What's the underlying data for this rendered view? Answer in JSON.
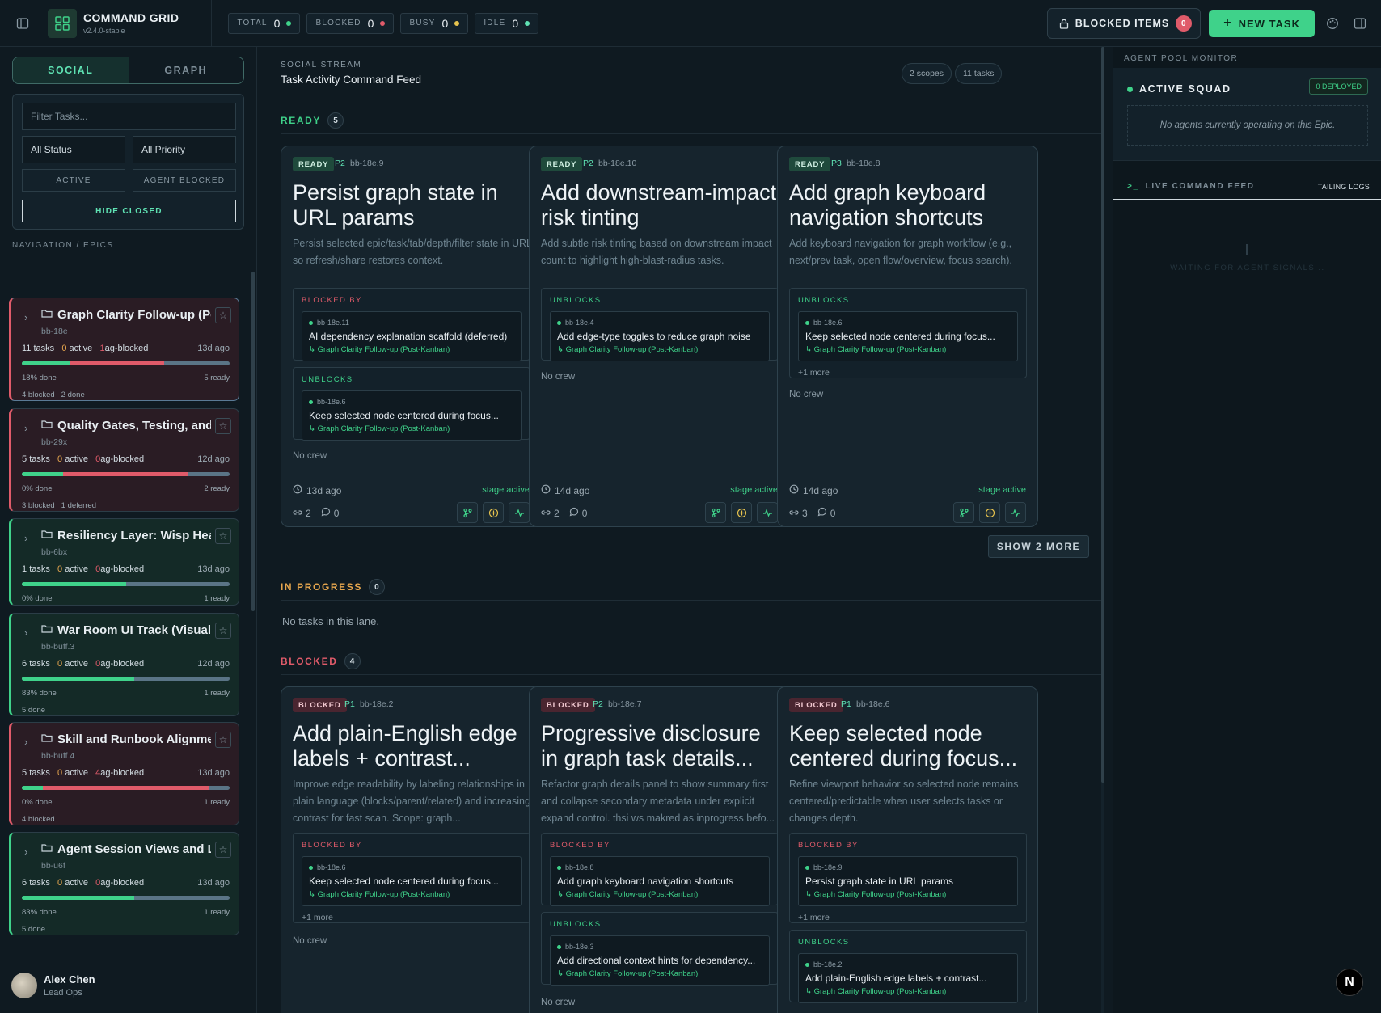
{
  "app": {
    "title": "COMMAND GRID",
    "version": "v2.4.0-stable"
  },
  "counters": [
    {
      "label": "TOTAL",
      "value": "0",
      "color": "#3fd28a"
    },
    {
      "label": "BLOCKED",
      "value": "0",
      "color": "#e05b6a"
    },
    {
      "label": "BUSY",
      "value": "0",
      "color": "#e6c34e"
    },
    {
      "label": "IDLE",
      "value": "0",
      "color": "#5fe2b3"
    }
  ],
  "toolbar": {
    "blocked_label": "BLOCKED ITEMS",
    "blocked_count": "0",
    "new_task_label": "NEW TASK"
  },
  "sidebar": {
    "tabs": {
      "social": "SOCIAL",
      "graph": "GRAPH"
    },
    "filter": {
      "placeholder": "Filter Tasks...",
      "status": "All Status",
      "priority": "All Priority",
      "active": "ACTIVE",
      "agent_blocked": "AGENT BLOCKED",
      "hide_closed": "HIDE CLOSED"
    },
    "nav_label": "NAVIGATION / EPICS",
    "epics": [
      {
        "title": "Graph Clarity Follow-up (Post-Kanban)",
        "id": "bb-18e",
        "tasks": "11",
        "active": "0",
        "blocked": "1",
        "ago": "13d ago",
        "pct": "18% done",
        "ready": "5 ready",
        "foot": [
          "4 blocked",
          "2 done"
        ],
        "done_frac": 0.18,
        "ready_frac": 0.27,
        "blocked_frac": 0.45
      },
      {
        "title": "Quality Gates, Testing, and Release",
        "id": "bb-29x",
        "tasks": "5",
        "active": "0",
        "blocked": "0",
        "ago": "12d ago",
        "pct": "0% done",
        "ready": "2 ready",
        "foot": [
          "3 blocked",
          "1 deferred"
        ],
        "done_frac": 0.0,
        "ready_frac": 0.4,
        "blocked_frac": 0.6
      },
      {
        "title": "Resiliency Layer: Wisp Heartbeats",
        "id": "bb-6bx",
        "tasks": "1",
        "active": "0",
        "blocked": "0",
        "ago": "13d ago",
        "pct": "0% done",
        "ready": "1 ready",
        "foot": [],
        "done_frac": 0.0,
        "ready_frac": 1.0,
        "blocked_frac": 0.0
      },
      {
        "title": "War Room UI Track (Visual Polish)",
        "id": "bb-buff.3",
        "tasks": "6",
        "active": "0",
        "blocked": "0",
        "ago": "12d ago",
        "pct": "83% done",
        "ready": "1 ready",
        "foot": [
          "5 done"
        ],
        "done_frac": 0.83,
        "ready_frac": 0.17,
        "blocked_frac": 0.0
      },
      {
        "title": "Skill and Runbook Alignment",
        "id": "bb-buff.4",
        "tasks": "5",
        "active": "0",
        "blocked": "4",
        "ago": "13d ago",
        "pct": "0% done",
        "ready": "1 ready",
        "foot": [
          "4 blocked"
        ],
        "done_frac": 0.0,
        "ready_frac": 0.2,
        "blocked_frac": 0.8
      },
      {
        "title": "Agent Session Views and Logs",
        "id": "bb-u6f",
        "tasks": "6",
        "active": "0",
        "blocked": "0",
        "ago": "13d ago",
        "pct": "83% done",
        "ready": "1 ready",
        "foot": [
          "5 done"
        ],
        "done_frac": 0.83,
        "ready_frac": 0.17,
        "blocked_frac": 0.0
      }
    ],
    "epic_labels": {
      "tasks": "tasks",
      "active": "active",
      "blocked": "ag-blocked"
    },
    "user": {
      "name": "Alex Chen",
      "role": "Lead Ops"
    }
  },
  "main": {
    "stream_label": "SOCIAL STREAM",
    "stream_title": "Task Activity Command Feed",
    "scopes": "2 scopes",
    "tasks": "11 tasks",
    "lanes": {
      "ready": {
        "label": "READY",
        "count": "5"
      },
      "progress": {
        "label": "IN PROGRESS",
        "count": "0",
        "empty": "No tasks in this lane."
      },
      "blocked": {
        "label": "BLOCKED",
        "count": "4"
      }
    },
    "show_more": "SHOW 2 MORE",
    "labels": {
      "blocked_by": "BLOCKED BY",
      "unblocks": "UNBLOCKS",
      "no_crew": "No crew",
      "stage": "stage active"
    },
    "ready_cards": [
      {
        "status": "READY",
        "prio": "P2",
        "id": "bb-18e.9",
        "title": "Persist graph state in URL params",
        "desc": "Persist selected epic/task/tab/depth/filter state in URL so refresh/share restores context.",
        "blocked_by": {
          "id": "bb-18e.11",
          "title": "AI dependency explanation scaffold (deferred)",
          "epic": "↳ Graph Clarity Follow-up (Post-Kanban)"
        },
        "unblocks": {
          "id": "bb-18e.6",
          "title": "Keep selected node centered during focus...",
          "epic": "↳ Graph Clarity Follow-up (Post-Kanban)"
        },
        "ago": "13d ago",
        "links": "2",
        "comments": "0"
      },
      {
        "status": "READY",
        "prio": "P2",
        "id": "bb-18e.10",
        "title": "Add downstream-impact risk tinting",
        "desc": "Add subtle risk tinting based on downstream impact count to highlight high-blast-radius tasks.",
        "unblocks": {
          "id": "bb-18e.4",
          "title": "Add edge-type toggles to reduce graph noise",
          "epic": "↳ Graph Clarity Follow-up (Post-Kanban)"
        },
        "ago": "14d ago",
        "links": "2",
        "comments": "0"
      },
      {
        "status": "READY",
        "prio": "P3",
        "id": "bb-18e.8",
        "title": "Add graph keyboard navigation shortcuts",
        "desc": "Add keyboard navigation for graph workflow (e.g., next/prev task, open flow/overview, focus search).",
        "unblocks": {
          "id": "bb-18e.6",
          "title": "Keep selected node centered during focus...",
          "epic": "↳ Graph Clarity Follow-up (Post-Kanban)",
          "more": "+1 more"
        },
        "ago": "14d ago",
        "links": "3",
        "comments": "0"
      }
    ],
    "blocked_cards": [
      {
        "status": "BLOCKED",
        "prio": "P1",
        "id": "bb-18e.2",
        "title": "Add plain-English edge labels + contrast...",
        "desc": "Improve edge readability by labeling relationships in plain language (blocks/parent/related) and increasing contrast for fast scan. Scope: graph...",
        "blocked_by": {
          "id": "bb-18e.6",
          "title": "Keep selected node centered during focus...",
          "epic": "↳ Graph Clarity Follow-up (Post-Kanban)",
          "more": "+1 more"
        }
      },
      {
        "status": "BLOCKED",
        "prio": "P2",
        "id": "bb-18e.7",
        "title": "Progressive disclosure in graph task details...",
        "desc": "Refactor graph details panel to show summary first and collapse secondary metadata under explicit expand control. thsi ws makred as inprogress befo...",
        "blocked_by": {
          "id": "bb-18e.8",
          "title": "Add graph keyboard navigation shortcuts",
          "epic": "↳ Graph Clarity Follow-up (Post-Kanban)"
        },
        "unblocks": {
          "id": "bb-18e.3",
          "title": "Add directional context hints for dependency...",
          "epic": "↳ Graph Clarity Follow-up (Post-Kanban)"
        }
      },
      {
        "status": "BLOCKED",
        "prio": "P1",
        "id": "bb-18e.6",
        "title": "Keep selected node centered during focus...",
        "desc": "Refine viewport behavior so selected node remains centered/predictable when user selects tasks or changes depth.",
        "blocked_by": {
          "id": "bb-18e.9",
          "title": "Persist graph state in URL params",
          "epic": "↳ Graph Clarity Follow-up (Post-Kanban)",
          "more": "+1 more"
        },
        "unblocks": {
          "id": "bb-18e.2",
          "title": "Add plain-English edge labels + contrast...",
          "epic": "↳ Graph Clarity Follow-up (Post-Kanban)"
        }
      }
    ]
  },
  "right": {
    "header": "AGENT POOL MONITOR",
    "squad_title": "ACTIVE SQUAD",
    "deployed": "0 DEPLOYED",
    "empty": "No agents currently operating on this Epic.",
    "feed_prompt": ">_",
    "feed_title": "LIVE COMMAND FEED",
    "tailing": "TAILING LOGS",
    "waiting": "WAITING FOR AGENT SIGNALS..."
  },
  "fab": {
    "label": "N"
  },
  "colors": {
    "accent": "#3fd28a",
    "danger": "#e05b6a",
    "warn": "#e6a64e"
  }
}
